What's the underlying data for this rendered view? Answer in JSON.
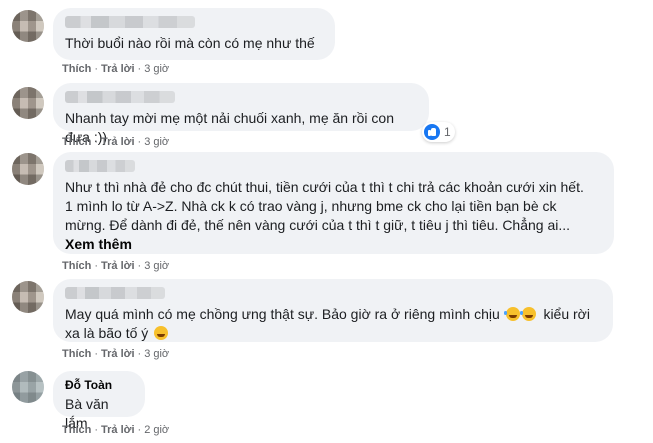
{
  "actions": {
    "like": "Thích",
    "reply": "Trả lời",
    "sep": "·"
  },
  "comments": [
    {
      "author": "",
      "text": "Thời buổi nào rồi mà còn có mẹ như thế",
      "time": "3 giờ"
    },
    {
      "author": "",
      "text": "Nhanh tay mời mẹ một nải chuối xanh, mẹ ăn rồi con đưa :))",
      "time": "3 giờ",
      "reaction_count": "1"
    },
    {
      "author": "",
      "text": "Như t thì nhà đẻ cho đc chút thui, tiền cưới của t thì t chi trả các khoản cưới xin hết.\n1 mình lo từ A->Z. Nhà ck k có trao vàng j, nhưng bme ck cho lại tiền bạn bè ck\nmừng. Để dành đi đẻ, thế nên vàng cưới của t thì t giữ, t tiêu j thì tiêu. Chẳng ai...",
      "see_more": "Xem thêm",
      "time": "3 giờ"
    },
    {
      "author": "",
      "text_line1": "May quá mình có mẹ chồng ưng thật sự. Bảo giờ ra ở riêng mình chịu",
      "text_line1b": "kiểu rời",
      "text_line2": "xa là bão tố ý",
      "time": "3 giờ"
    },
    {
      "author": "Đỗ Toàn",
      "text": "Bà văn lắm",
      "time": "2 giờ"
    }
  ]
}
